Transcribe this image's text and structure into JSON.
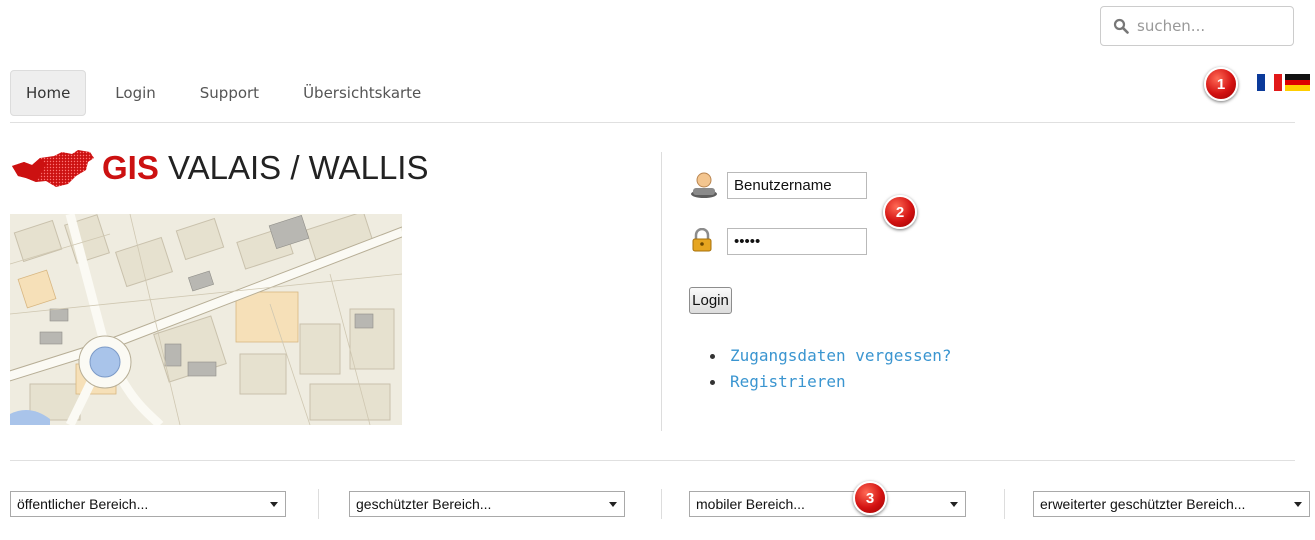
{
  "search": {
    "placeholder": "suchen..."
  },
  "nav": [
    {
      "label": "Home",
      "active": true
    },
    {
      "label": "Login"
    },
    {
      "label": "Support"
    },
    {
      "label": "Übersichtskarte"
    }
  ],
  "badges": [
    "1",
    "2",
    "3"
  ],
  "logo": {
    "gis": "GIS",
    "rest": "VALAIS / WALLIS"
  },
  "login": {
    "username_value": "Benutzername",
    "password_value": "*****",
    "button_label": "Login",
    "links": [
      "Zugangsdaten vergessen?",
      "Registrieren"
    ]
  },
  "dropdowns": [
    "öffentlicher Bereich...",
    "geschützter Bereich...",
    "mobiler Bereich...",
    "erweiterter geschützter Bereich..."
  ],
  "colors": {
    "brand_red": "#cc1111",
    "link_blue": "#3a95d0"
  },
  "icons": [
    "search-icon",
    "flag-france-icon",
    "flag-germany-icon",
    "user-icon",
    "lock-icon"
  ]
}
